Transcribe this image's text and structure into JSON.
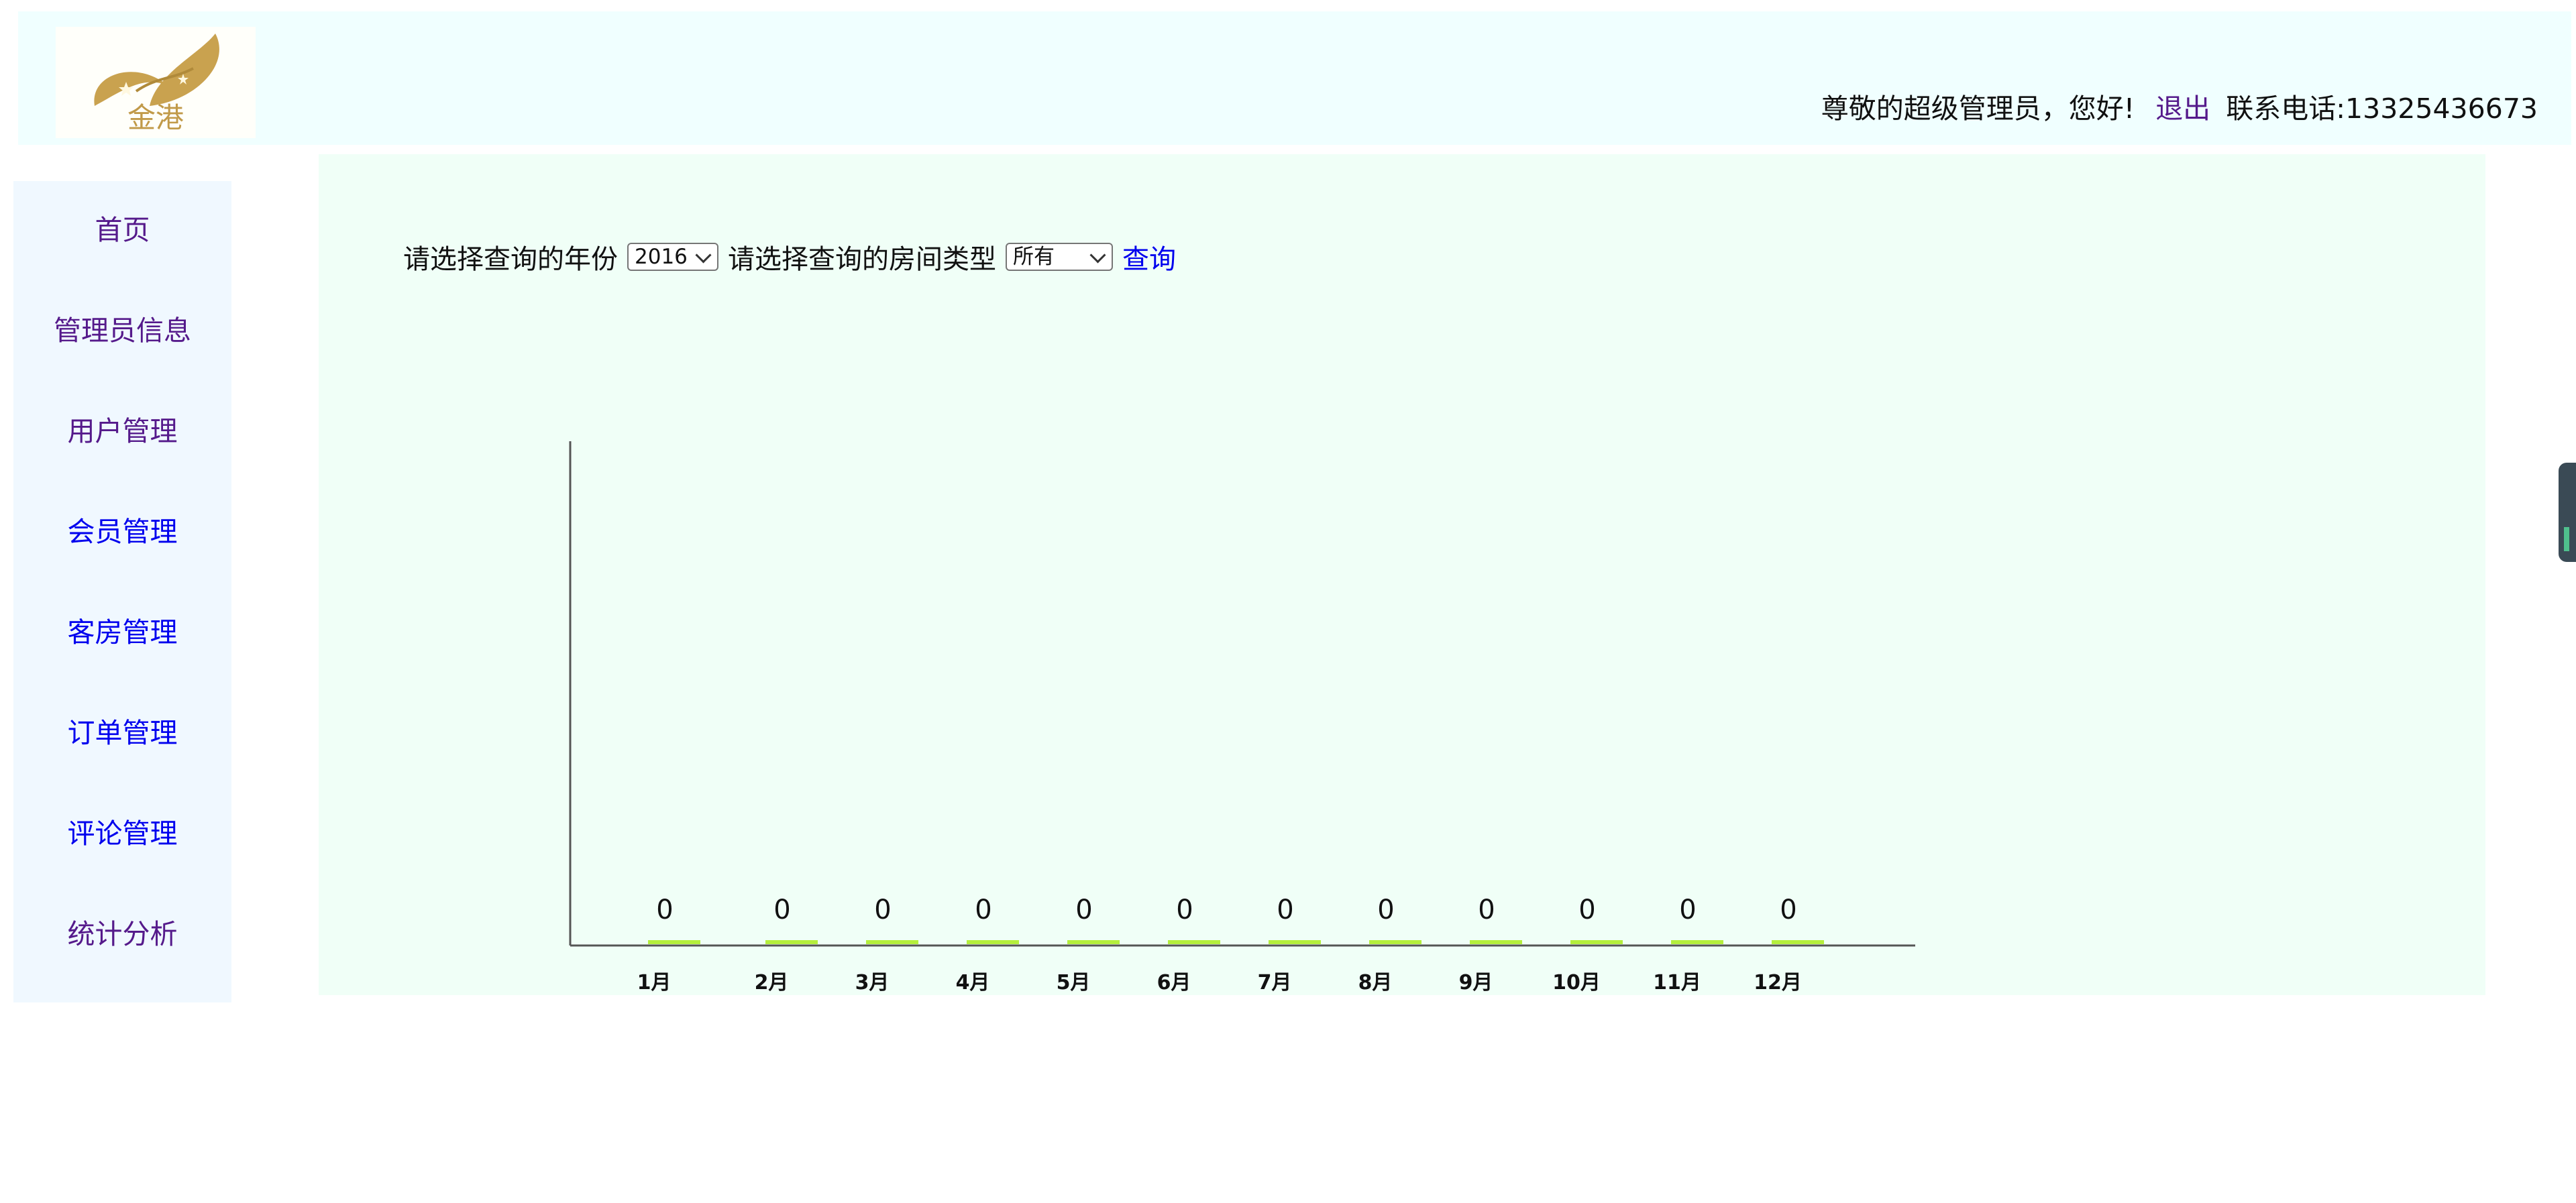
{
  "header": {
    "logo_text": "金港",
    "greeting": "尊敬的超级管理员，您好!",
    "logout_label": "退出",
    "contact": "联系电话:13325436673"
  },
  "sidebar": {
    "items": [
      {
        "label": "首页",
        "state": "visited"
      },
      {
        "label": "管理员信息",
        "state": "visited"
      },
      {
        "label": "用户管理",
        "state": "visited"
      },
      {
        "label": "会员管理",
        "state": "link"
      },
      {
        "label": "客房管理",
        "state": "link"
      },
      {
        "label": "订单管理",
        "state": "link"
      },
      {
        "label": "评论管理",
        "state": "link"
      },
      {
        "label": "统计分析",
        "state": "visited"
      }
    ]
  },
  "query": {
    "year_label": "请选择查询的年份",
    "year_value": "2016",
    "type_label": "请选择查询的房间类型",
    "type_value": "所有",
    "submit_label": "查询"
  },
  "colors": {
    "header_bg": "#f0ffff",
    "sidebar_bg": "#f0f8ff",
    "main_bg": "#f0fff7",
    "bar_color": "#b4ef3c",
    "visited_link": "#551a8b",
    "link": "#0000ee"
  },
  "chart_data": {
    "type": "bar",
    "title": "",
    "xlabel": "",
    "ylabel": "",
    "categories": [
      "1月",
      "2月",
      "3月",
      "4月",
      "5月",
      "6月",
      "7月",
      "8月",
      "9月",
      "10月",
      "11月",
      "12月"
    ],
    "values": [
      0,
      0,
      0,
      0,
      0,
      0,
      0,
      0,
      0,
      0,
      0,
      0
    ],
    "data_labels": [
      "0",
      "0",
      "0",
      "0",
      "0",
      "0",
      "0",
      "0",
      "0",
      "0",
      "0",
      "0"
    ],
    "grid": false,
    "legend": "none"
  }
}
